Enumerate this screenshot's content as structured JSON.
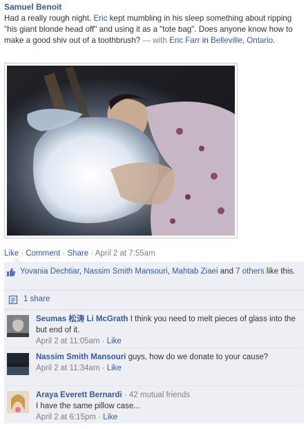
{
  "post": {
    "author": "Samuel Benoit",
    "text_1": "Had a really rough night. ",
    "mention_1": "Eric",
    "text_2": " kept mumbling in his sleep something about ripping \"his giant blonde head off\" and using it as a \"tote bag\". Does anyone know how to make a good shiv out of a toothbrush?",
    "with_label": " — with ",
    "mention_2": "Eric Farr",
    "in_label": " in ",
    "location": "Belleville, Ontario",
    "period": "."
  },
  "actions": {
    "like": "Like",
    "comment": "Comment",
    "share": "Share",
    "separator": " · ",
    "timestamp": "April 2 at 7:55am"
  },
  "likes": {
    "name_1": "Yovania Dechtiar",
    "name_2": "Nassim Smith Mansouri",
    "name_3": "Mahtab Ziaei",
    "and_label": " and ",
    "others": "7 others",
    "suffix": " like this.",
    "comma": ", "
  },
  "shares": {
    "label": "1 share"
  },
  "comments": [
    {
      "name": "Seumas 松涛 Li McGrath",
      "mutual": "",
      "text": "I think you need to melt pieces of glass into the but end of it.",
      "time": "April 2 at 11:05am",
      "like": "Like"
    },
    {
      "name": "Nassim Smith Mansouri",
      "mutual": "",
      "text": "guys, how do we donate to your cause?",
      "time": "April 2 at 11:34am",
      "like": "Like"
    },
    {
      "name": "Araya Everett Bernardi",
      "mutual": "· 42 mutual friends",
      "text": "I have the same pillow case...",
      "time": "April 2 at 6:15pm",
      "like": "Like"
    }
  ],
  "colors": {
    "link": "#3b5998",
    "meta": "#7f7f7f",
    "feedback_bg": "#edeff4"
  },
  "icons": {
    "like": "thumbs-up-icon",
    "share": "share-icon"
  }
}
